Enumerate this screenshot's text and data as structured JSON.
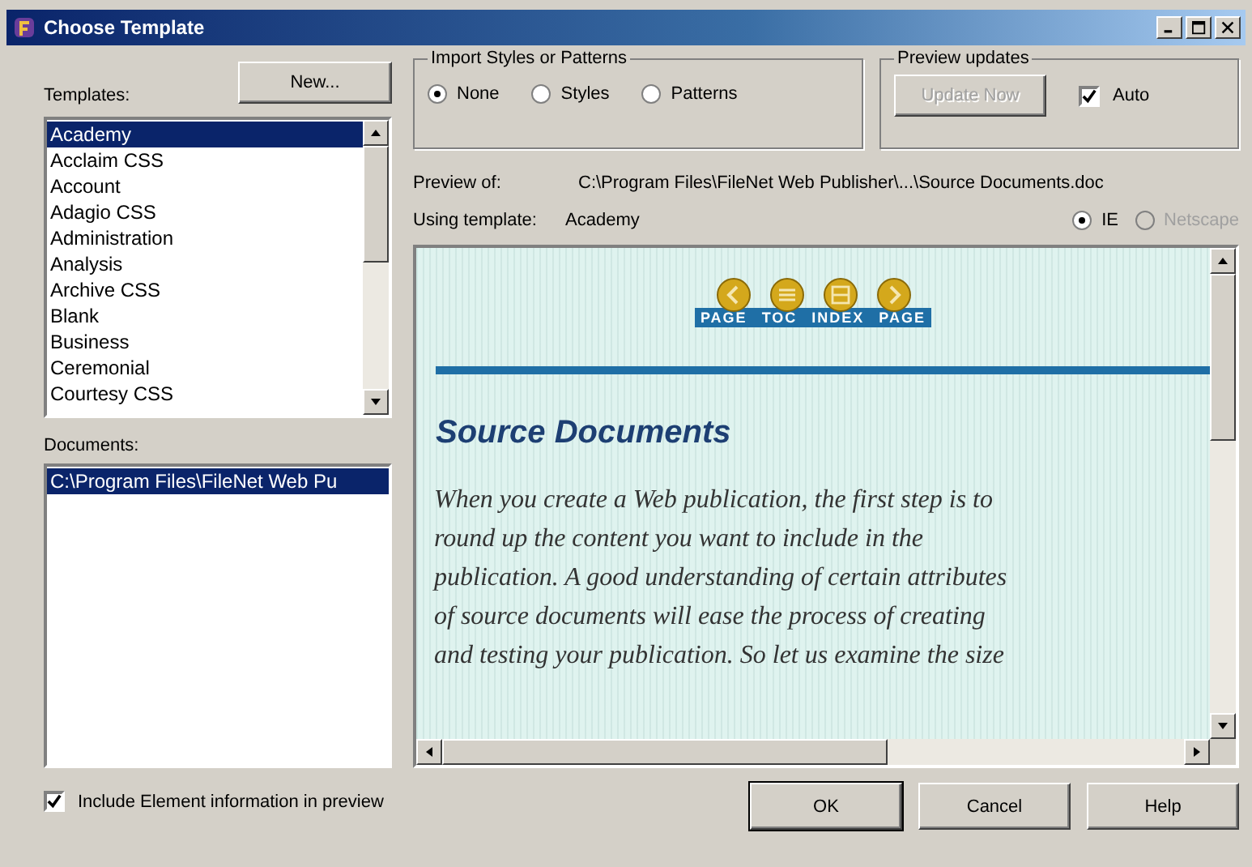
{
  "window": {
    "title": "Choose Template"
  },
  "templates": {
    "label": "Templates:",
    "new_button": "New...",
    "items": [
      {
        "label": "Academy",
        "selected": true
      },
      {
        "label": "Acclaim CSS",
        "selected": false
      },
      {
        "label": "Account",
        "selected": false
      },
      {
        "label": "Adagio CSS",
        "selected": false
      },
      {
        "label": "Administration",
        "selected": false
      },
      {
        "label": "Analysis",
        "selected": false
      },
      {
        "label": "Archive CSS",
        "selected": false
      },
      {
        "label": "Blank",
        "selected": false
      },
      {
        "label": "Business",
        "selected": false
      },
      {
        "label": "Ceremonial",
        "selected": false
      },
      {
        "label": "Courtesy CSS",
        "selected": false
      }
    ]
  },
  "documents": {
    "label": "Documents:",
    "items": [
      {
        "label": "C:\\Program Files\\FileNet Web Pu",
        "selected": true
      }
    ]
  },
  "import": {
    "title": "Import Styles or Patterns",
    "options": [
      {
        "label": "None",
        "selected": true
      },
      {
        "label": "Styles",
        "selected": false
      },
      {
        "label": "Patterns",
        "selected": false
      }
    ]
  },
  "preview_updates": {
    "title": "Preview updates",
    "update_button": {
      "label": "Update Now",
      "disabled": true
    },
    "auto": {
      "label": "Auto",
      "checked": true
    }
  },
  "preview_of": {
    "label": "Preview of:",
    "value": "C:\\Program Files\\FileNet Web Publisher\\...\\Source Documents.doc"
  },
  "using_template": {
    "label": "Using template:",
    "value": "Academy"
  },
  "browsers": [
    {
      "label": "IE",
      "selected": true,
      "disabled": false
    },
    {
      "label": "Netscape",
      "selected": false,
      "disabled": true
    }
  ],
  "preview": {
    "nav": [
      {
        "kind": "prev",
        "label": "PAGE"
      },
      {
        "kind": "toc",
        "label": "TOC"
      },
      {
        "kind": "index",
        "label": "INDEX"
      },
      {
        "kind": "next",
        "label": "PAGE"
      }
    ],
    "heading": "Source Documents",
    "body_lines": [
      "When you create a Web publication, the first step is to",
      "round up the content you want to include in the",
      "publication. A good understanding of certain attributes",
      "of source documents will ease the process of creating",
      "and testing your publication. So let us examine the size"
    ]
  },
  "include_element": {
    "label": "Include Element information in preview",
    "checked": true
  },
  "buttons": [
    {
      "label": "OK",
      "default": true
    },
    {
      "label": "Cancel",
      "default": false
    },
    {
      "label": "Help",
      "default": false
    }
  ]
}
